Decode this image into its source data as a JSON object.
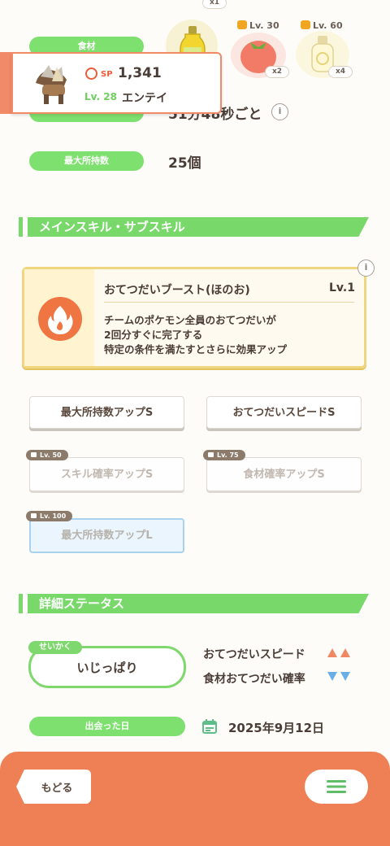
{
  "top": {
    "ingredient_label": "食材",
    "ingredients": [
      {
        "name": "oil",
        "lv": "",
        "qty": "x1",
        "color": "#f5dd43"
      },
      {
        "name": "tomato",
        "lv": "Lv. 30",
        "qty": "x2",
        "color": "#f58d7b"
      },
      {
        "name": "milk",
        "lv": "Lv. 60",
        "qty": "x4",
        "color": "#fbf4c8"
      }
    ],
    "help_interval_value": "51分48秒ごと",
    "max_carry_label": "最大所持数",
    "max_carry_value": "25個"
  },
  "pokemon": {
    "sp_label": "SP",
    "sp_value": "1,341",
    "level": "Lv. 28",
    "name": "エンテイ"
  },
  "main_skill_section": {
    "title": "メインスキル・サブスキル",
    "skill_name": "おてつだいブースト(ほのお)",
    "skill_level": "Lv.1",
    "skill_desc": [
      "チームのポケモン全員のおてつだいが",
      "2回分すぐに完了する",
      "特定の条件を満たすとさらに効果アップ"
    ],
    "info_icon": "info-icon"
  },
  "sub_skills": [
    {
      "label": "最大所持数アップS",
      "locked": false,
      "lv": ""
    },
    {
      "label": "おてつだいスピードS",
      "locked": false,
      "lv": ""
    },
    {
      "label": "スキル確率アップS",
      "locked": true,
      "lv": "Lv. 50"
    },
    {
      "label": "食材確率アップS",
      "locked": true,
      "lv": "Lv. 75"
    },
    {
      "label": "最大所持数アップL",
      "locked": true,
      "lv": "Lv. 100"
    }
  ],
  "detail_section": {
    "title": "詳細ステータス",
    "nature_tag": "せいかく",
    "nature_value": "いじっぱり",
    "up_stat": "おてつだいスピード",
    "down_stat": "食材おてつだい確率",
    "met_label": "出会った日",
    "met_date": "2025年9月12日"
  },
  "nav": {
    "back_label": "もどる",
    "menu_icon": "hamburger-menu-icon"
  },
  "colors": {
    "green": "#78d86a",
    "orange": "#ef7f55",
    "gold": "#f1d680",
    "up_arrow": "#f08864",
    "down_arrow": "#6aaee8"
  }
}
